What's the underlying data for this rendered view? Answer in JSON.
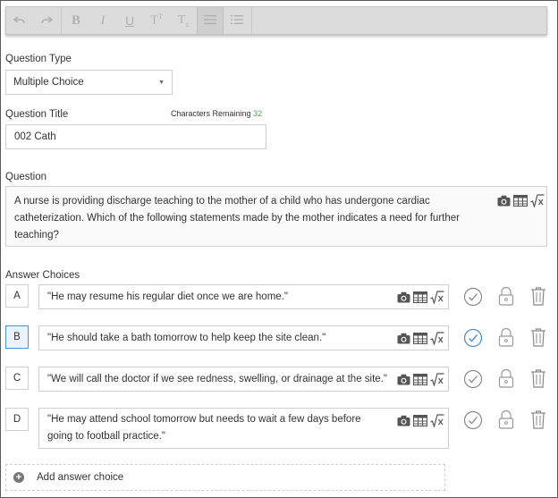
{
  "toolbar": {
    "buttons": [
      {
        "name": "undo-icon",
        "glyph": "↶"
      },
      {
        "name": "redo-icon",
        "glyph": "↷"
      },
      {
        "name": "bold-icon",
        "glyph": "B"
      },
      {
        "name": "italic-icon",
        "glyph": "I"
      },
      {
        "name": "underline-icon",
        "glyph": "U"
      },
      {
        "name": "superscript-icon",
        "glyph": "T"
      },
      {
        "name": "subscript-icon",
        "glyph": "T"
      },
      {
        "name": "bulleted-list-icon",
        "glyph": "☰"
      },
      {
        "name": "numbered-list-icon",
        "glyph": "☷"
      }
    ]
  },
  "question_type": {
    "label": "Question Type",
    "value": "Multiple Choice"
  },
  "question_title": {
    "label": "Question Title",
    "chars_label": "Characters Remaining",
    "chars_count": "32",
    "value": "002 Cath"
  },
  "question": {
    "label": "Question",
    "text": "A nurse is providing discharge teaching to the mother of a child who has undergone cardiac catheterization. Which of the following statements made by the mother indicates a need for further teaching?"
  },
  "answers": {
    "label": "Answer Choices",
    "items": [
      {
        "letter": "A",
        "text": "\"He may resume his regular diet once we are home.\"",
        "correct": false
      },
      {
        "letter": "B",
        "text": "\"He should take a bath tomorrow to help keep the site clean.\"",
        "correct": true
      },
      {
        "letter": "C",
        "text": "\"We will call the doctor if we see redness, swelling, or drainage at the site.\"",
        "correct": false
      },
      {
        "letter": "D",
        "text": "\"He may attend school tomorrow but needs to wait a few days before going to football practice.\"",
        "correct": false
      }
    ],
    "add_label": "Add answer choice"
  },
  "colors": {
    "accent": "#4a90d9",
    "chars_count": "#4aa54a"
  }
}
